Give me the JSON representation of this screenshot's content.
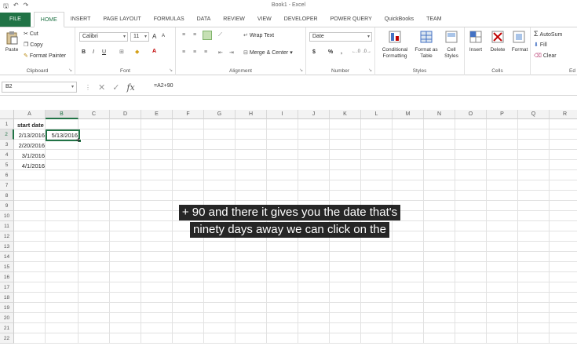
{
  "window": {
    "title": "Book1 - Excel",
    "accent": "#217346"
  },
  "quick_access": [
    "save-icon",
    "undo-icon",
    "redo-icon"
  ],
  "tabs": [
    {
      "label": "FILE"
    },
    {
      "label": "HOME"
    },
    {
      "label": "INSERT"
    },
    {
      "label": "PAGE LAYOUT"
    },
    {
      "label": "FORMULAS"
    },
    {
      "label": "DATA"
    },
    {
      "label": "REVIEW"
    },
    {
      "label": "VIEW"
    },
    {
      "label": "DEVELOPER"
    },
    {
      "label": "POWER QUERY"
    },
    {
      "label": "QuickBooks"
    },
    {
      "label": "TEAM"
    }
  ],
  "ribbon": {
    "clipboard": {
      "label": "Clipboard",
      "paste": "Paste",
      "cut": "Cut",
      "copy": "Copy",
      "format_painter": "Format Painter"
    },
    "font": {
      "label": "Font",
      "family": "Calibri",
      "size": "11",
      "grow": "A",
      "shrink": "A",
      "bold": "B",
      "italic": "I",
      "underline": "U"
    },
    "alignment": {
      "label": "Alignment",
      "wrap_text": "Wrap Text",
      "merge_center": "Merge & Center"
    },
    "number": {
      "label": "Number",
      "format": "Date",
      "currency": "$",
      "percent": "%",
      "comma": ","
    },
    "styles": {
      "label": "Styles",
      "conditional_formatting": "Conditional Formatting",
      "format_as_table": "Format as Table",
      "cell_styles": "Cell Styles"
    },
    "cells": {
      "label": "Cells",
      "insert": "Insert",
      "delete": "Delete",
      "format": "Format"
    },
    "editing": {
      "label": "Ed",
      "autosum": "AutoSum",
      "fill": "Fill",
      "clear": "Clear"
    }
  },
  "formula_bar": {
    "name_box": "B2",
    "formula": "=A2+90"
  },
  "grid": {
    "columns": [
      "A",
      "B",
      "C",
      "D",
      "E",
      "F",
      "G",
      "H",
      "I",
      "J",
      "K",
      "L",
      "M",
      "N",
      "O",
      "P",
      "Q",
      "R"
    ],
    "rows": [
      "1",
      "2",
      "3",
      "4",
      "5",
      "6",
      "7",
      "8",
      "9",
      "10",
      "11",
      "12",
      "13",
      "14",
      "15",
      "16",
      "17",
      "18",
      "19",
      "20",
      "21",
      "22"
    ],
    "cells": {
      "A1": "start date",
      "A2": "2/13/2016",
      "A3": "2/20/2016",
      "A4": "3/1/2016",
      "A5": "4/1/2016",
      "B2": "5/13/2016"
    },
    "active_cell": "B2"
  },
  "caption": {
    "line1": "+ 90 and there it gives you the date that's",
    "line2": "ninety days away we can click on the"
  }
}
